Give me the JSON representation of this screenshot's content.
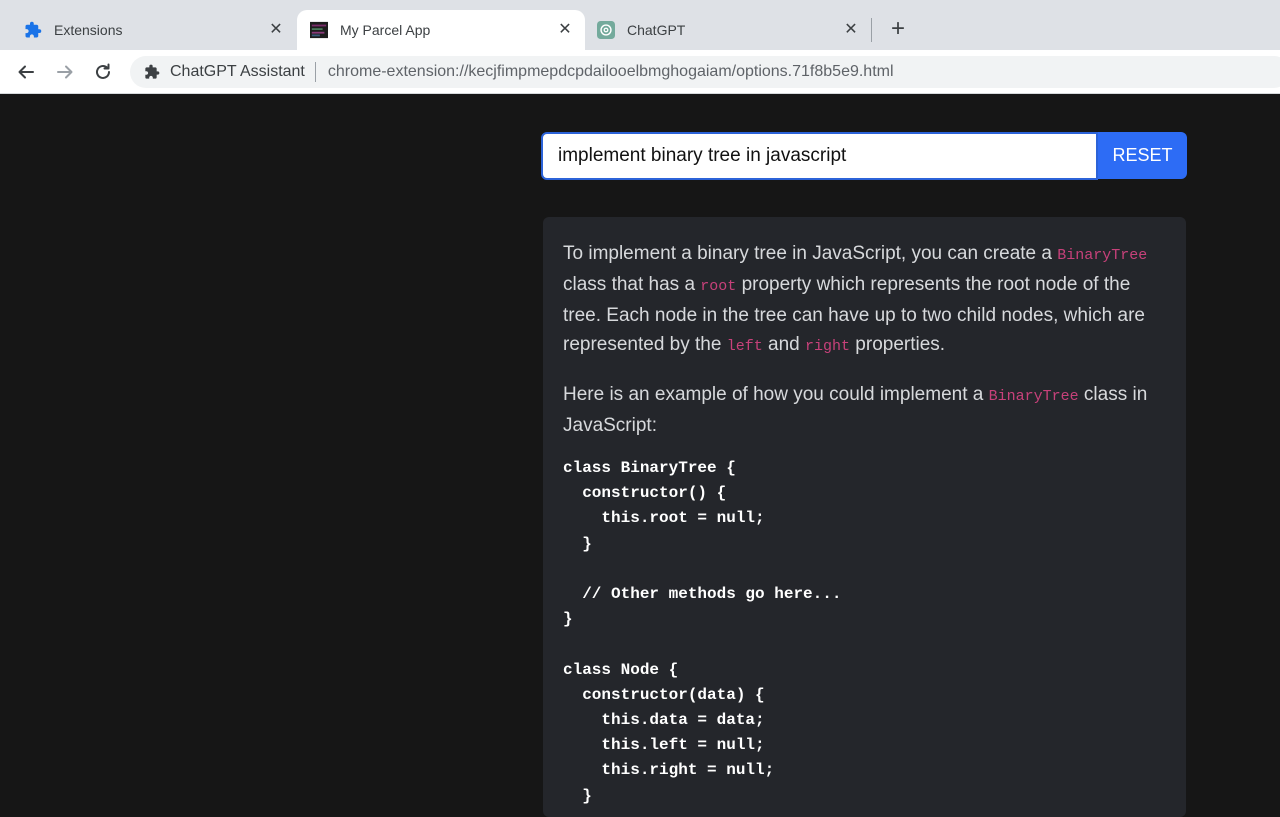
{
  "tabs": [
    {
      "title": "Extensions",
      "icon": "puzzle-icon"
    },
    {
      "title": "My Parcel App",
      "icon": "app-favicon",
      "active": true
    },
    {
      "title": "ChatGPT",
      "icon": "openai-icon"
    }
  ],
  "toolbar": {
    "extension_name": "ChatGPT Assistant",
    "url": "chrome-extension://kecjfimpmepdcpdailooelbmghogaiam/options.71f8b5e9.html"
  },
  "search": {
    "value": "implement binary tree in javascript",
    "reset_label": "RESET"
  },
  "answer": {
    "p1": {
      "t1": "To implement a binary tree in JavaScript, you can create a ",
      "c1": "BinaryTree",
      "t2": " class that has a ",
      "c2": "root",
      "t3": " property which represents the root node of the tree. Each node in the tree can have up to two child nodes, which are represented by the ",
      "c3": "left",
      "t4": " and ",
      "c4": "right",
      "t5": " properties."
    },
    "p2": {
      "t1": "Here is an example of how you could implement a ",
      "c1": "BinaryTree",
      "t2": " class in JavaScript:"
    },
    "code": "class BinaryTree {\n  constructor() {\n    this.root = null;\n  }\n\n  // Other methods go here...\n}\n\nclass Node {\n  constructor(data) {\n    this.data = data;\n    this.left = null;\n    this.right = null;\n  }"
  },
  "colors": {
    "accent": "#2d6cf5",
    "inline_code": "#c7417a",
    "panel": "#24262b",
    "page_bg": "#161616"
  }
}
